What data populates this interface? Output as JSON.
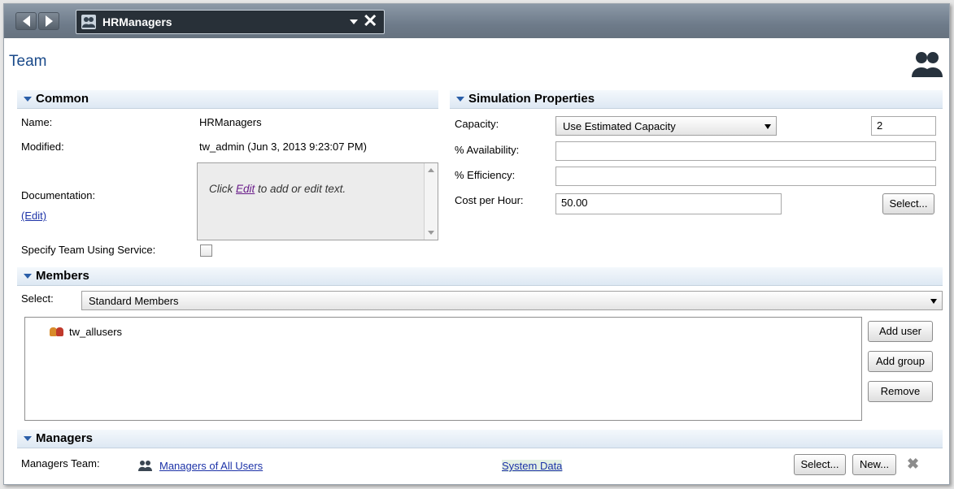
{
  "editor_tab": {
    "title": "HRManagers"
  },
  "page": {
    "title": "Team"
  },
  "common": {
    "header": "Common",
    "name_label": "Name:",
    "name_value": "HRManagers",
    "modified_label": "Modified:",
    "modified_value": "tw_admin (Jun 3, 2013 9:23:07 PM)",
    "documentation_label": "Documentation:",
    "edit_link": "(Edit)",
    "doc_placeholder_pre": "Click ",
    "doc_placeholder_link": "Edit",
    "doc_placeholder_post": " to add or edit text.",
    "specify_label": "Specify Team Using Service:",
    "specify_checked": false
  },
  "simulation": {
    "header": "Simulation Properties",
    "capacity_label": "Capacity:",
    "capacity_select": "Use Estimated Capacity",
    "capacity_value": "2",
    "availability_label": "% Availability:",
    "availability_value": "",
    "efficiency_label": "% Efficiency:",
    "efficiency_value": "",
    "cost_label": "Cost per Hour:",
    "cost_value": "50.00",
    "select_button": "Select..."
  },
  "members": {
    "header": "Members",
    "select_label": "Select:",
    "select_value": "Standard Members",
    "items": [
      {
        "name": "tw_allusers"
      }
    ],
    "add_user": "Add user",
    "add_group": "Add group",
    "remove": "Remove"
  },
  "managers": {
    "header": "Managers",
    "team_label": "Managers Team:",
    "team_link": "Managers of All Users",
    "system_data": "System Data",
    "select_button": "Select...",
    "new_button": "New...",
    "clear_icon": "x-icon"
  }
}
